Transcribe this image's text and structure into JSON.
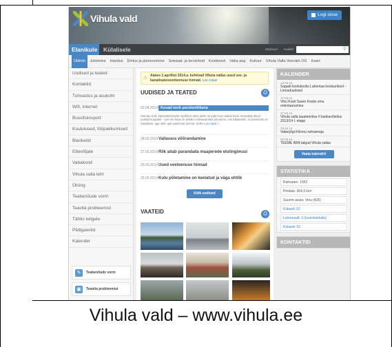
{
  "site": {
    "logo_text": "Vihula vald",
    "login_label": "Logi sisse"
  },
  "audience_tabs": [
    {
      "label": "Elanikule",
      "active": true
    },
    {
      "label": "Külalisele",
      "active": false
    }
  ],
  "top_links": [
    "Struktuur",
    "Avaldid"
  ],
  "search": {
    "placeholder": "",
    "icon": "search-icon"
  },
  "subnav": [
    "Üldinfo",
    "Juhtimine",
    "Haridus",
    "Ehitus ja planeerimine",
    "Sotsiaal- ja tervishoid",
    "Keskkond",
    "Vaba aeg",
    "Kultuur",
    "Vihula Valla Veevärk OÜ",
    "Kaart"
  ],
  "sidebar": {
    "items": [
      "Uudised ja teated",
      "Kontaktid",
      "Tuhvastus ja asukoht",
      "Wifi, internet",
      "Bussitransport",
      "Kuulutused, tööpakkumised",
      "Blanketid",
      "Ettevõtjale",
      "Vabakond",
      "Vihula valla leht",
      "Otsing",
      "Teabenõude vorm",
      "Teavita probleemist",
      "Tähtis teligele",
      "Pildigaleriid",
      "Kalender"
    ],
    "quick_links": [
      "Teabenõude vorm",
      "Teavita probleemist"
    ]
  },
  "notice": {
    "text": "Alates 1.aprillist 2014.a. kehtivad Vihula vallas uued vee- ja kanalisatsiooniteenuse hinnad.",
    "link": "Loe edasi"
  },
  "news": {
    "heading": "UUDISED JA TEATED",
    "featured": {
      "date": "02.04.2014",
      "title": "Kevad tooh perslonlitilana",
      "excerpt": "Heiman Külli, külastalimissider Aprillinus ekes pikes on jutta koos aastal mere eessaleta aleud uudisid kuupäeb – just ete kaas on Essiku mõelaeamitud perioeme, mis tükkenäsh, et pensionile on Sasalbusi, aga olein igal aastal taa toimub. Selle!",
      "more": "Loe edasi »"
    },
    "items": [
      {
        "date": "28.03.2014",
        "title": "Vallavara võõrandamine"
      },
      {
        "date": "27.03.2014",
        "title": "Riik aitab parandada maaperede elutingimusi"
      },
      {
        "date": "25.03.2014",
        "title": "Uued veeteenuse hinnad"
      },
      {
        "date": "25.03.2014",
        "title": "Kulu põletamine on keelatud ja väga ohtlik"
      }
    ],
    "all_button": "Kõik uudised"
  },
  "gallery": {
    "heading": "VAATEID"
  },
  "calendar": {
    "heading": "KALENDER",
    "entries": [
      {
        "date": "13.04.14",
        "title": "Sagadi koolukoolis Lahemaa loodusrikool - Linnuduuloisel"
      },
      {
        "date": "17.04.14",
        "title": "Vihu Kooli Saare Koolis oma orientaarumina"
      },
      {
        "date": "27.04.14",
        "title": "Vihula valla lauatenniise II karikavõistlus 2013/14 I. etapp"
      },
      {
        "date": "26.04.14",
        "title": "Vaberjõgi Kõrsnu rahvamaja"
      },
      {
        "date": "03.05.14",
        "title": "TEEME ÄRA talgud Vihula vallas"
      }
    ],
    "button": "Vaata kalendrit"
  },
  "statistics": {
    "heading": "STATISTIKA",
    "rows": [
      {
        "text": "Rahvaarv: 1952",
        "link": false
      },
      {
        "text": "Pindala: 364,9 km²",
        "link": false
      },
      {
        "text": "Suurim asula: Vinu (425)",
        "link": false
      },
      {
        "text": "Külasid: 52",
        "link": true
      },
      {
        "text": "Lahemaalt: 3 (tsoonilahtulla)",
        "link": true
      },
      {
        "text": "Külaedi: 52",
        "link": true
      }
    ]
  },
  "contacts": {
    "heading": "KONTAKTID"
  },
  "caption": "Vihula vald – www.vihula.ee",
  "colors": {
    "accent": "#4a87c4",
    "nav_dark": "#3d3f42",
    "notice_bg": "#fffbdc"
  }
}
